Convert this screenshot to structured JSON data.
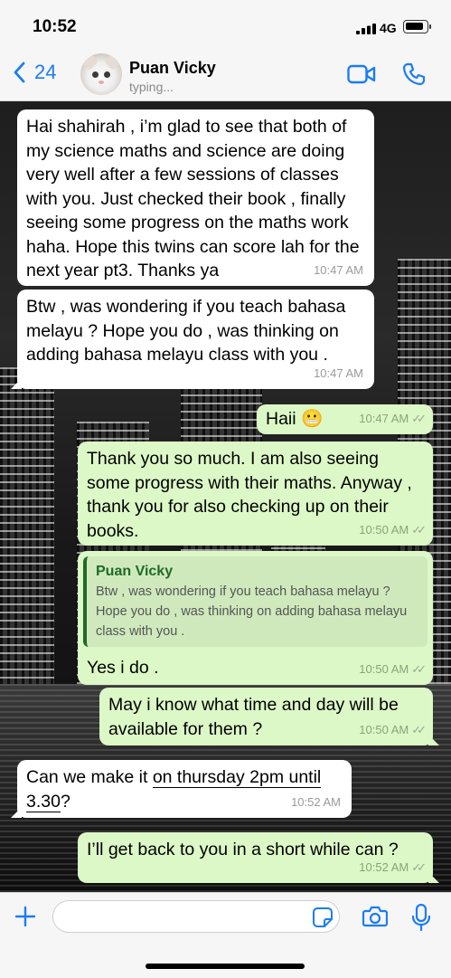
{
  "status_bar": {
    "time": "10:52",
    "network": "4G"
  },
  "header": {
    "back_count": "24",
    "contact_name": "Puan Vicky",
    "status": "typing..."
  },
  "messages": [
    {
      "direction": "in",
      "text": "Hai shahirah , i’m glad to see that both of my science maths and science are doing very well after a few sessions of classes with you. Just checked their book , finally seeing some progress on the maths work haha. Hope this twins can score lah for the next year pt3. Thanks ya",
      "time": "10:47 AM"
    },
    {
      "direction": "in",
      "text": "Btw , was wondering if you teach bahasa melayu ? Hope you do , was thinking on adding bahasa melayu class with you .",
      "time": "10:47 AM"
    },
    {
      "direction": "out",
      "text": "Haii 😬",
      "time": "10:47 AM"
    },
    {
      "direction": "out",
      "text": "Thank you so much. I am also seeing some progress with their maths. Anyway , thank you for also checking up on their books.",
      "time": "10:50 AM"
    },
    {
      "direction": "out",
      "quote_name": "Puan Vicky",
      "quote_text": "Btw , was wondering if you teach bahasa melayu ? Hope you do , was thinking on adding bahasa melayu class with you .",
      "text": "Yes i do .",
      "time": "10:50 AM"
    },
    {
      "direction": "out",
      "text": "May i know what time and day will be available for them ?",
      "time": "10:50 AM"
    },
    {
      "direction": "in",
      "text_before": "Can we make it ",
      "text_link": "on thursday 2pm until 3.30",
      "text_after": "?",
      "time": "10:52 AM"
    },
    {
      "direction": "out",
      "text": "I’ll get back to you in a short while can ?",
      "time": "10:52 AM"
    }
  ],
  "composer": {
    "placeholder": ""
  },
  "colors": {
    "accent": "#1a7cf5",
    "outgoing": "#dcf8c6",
    "incoming": "#ffffff"
  },
  "icons": [
    "back-chevron-icon",
    "video-call-icon",
    "phone-icon",
    "plus-icon",
    "sticker-icon",
    "camera-icon",
    "microphone-icon",
    "double-check-icon"
  ]
}
